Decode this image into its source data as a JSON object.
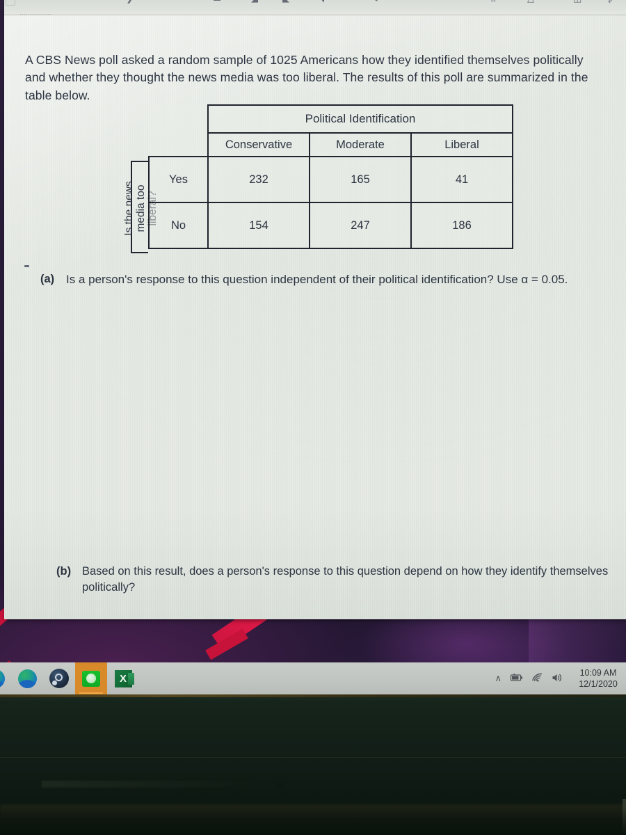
{
  "document": {
    "intro": "A CBS News poll asked a random sample of 1025 Americans how they identified themselves politically and whether they thought the news media was too liberal.  The results of this poll are summarized in the table below.",
    "row_variable_label": "Is the news\nmedia too\nliberal?",
    "parts": [
      {
        "tag": "(a)",
        "text": "Is a person's response to this question independent of their political identification? Use α = 0.05."
      },
      {
        "tag": "(b)",
        "text": "Based on this result, does a person's response to this question depend on how they identify themselves politically?"
      }
    ],
    "toolbar_hint_label": "...............",
    "toolbar_icons": [
      "cursor-icon",
      "underline-icon",
      "paragraph-mark-icon",
      "highlighter-icon",
      "pen-icon",
      "eraser-icon",
      "shapes-icon",
      "ruler-icon",
      "lasso-icon"
    ]
  },
  "chart_data": {
    "type": "table",
    "title": "Political Identification",
    "supercolumn_header": "Political Identification",
    "row_group_header": "Is the news media too liberal?",
    "categories": [
      "Conservative",
      "Moderate",
      "Liberal"
    ],
    "row_labels": [
      "Yes",
      "No"
    ],
    "rows": [
      {
        "label": "Yes",
        "values": [
          232,
          165,
          41
        ]
      },
      {
        "label": "No",
        "values": [
          154,
          247,
          186
        ]
      }
    ],
    "sample_size": 1025,
    "alpha": 0.05,
    "grid": true,
    "border_color": "#20242e"
  },
  "taskbar": {
    "items": [
      {
        "name": "browser-edge-left",
        "icon": "edge-icon",
        "active": false
      },
      {
        "name": "browser-edge",
        "icon": "edge-icon",
        "active": false
      },
      {
        "name": "steam-app",
        "icon": "steam-icon",
        "active": false
      },
      {
        "name": "green-app",
        "icon": "green-circle-app-icon",
        "active": true
      },
      {
        "name": "excel-app",
        "icon": "excel-icon",
        "label": "X",
        "active": false
      }
    ],
    "tray": {
      "chevron": "∧",
      "battery": "▮",
      "wifi": "◠",
      "volume": "🔊",
      "time": "10:09 AM",
      "date": "12/1/2020"
    }
  },
  "colors": {
    "page_background": "#e3e7e1",
    "text": "#2c3441",
    "table_border": "#20242e",
    "taskbar": "#c2c6c2",
    "taskbar_active": "#d88a2a",
    "wallpaper": "#2b1f3c",
    "wallpaper_accent": "#d1173f"
  }
}
